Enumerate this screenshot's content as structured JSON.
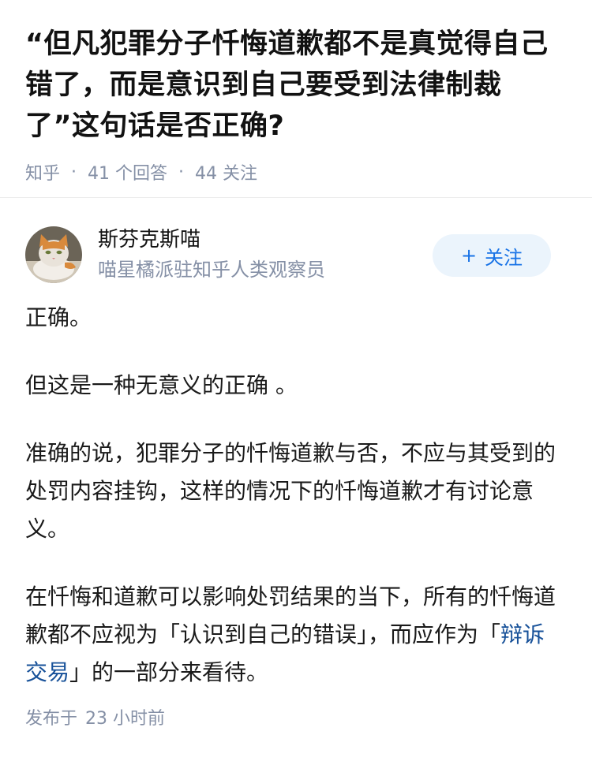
{
  "question": {
    "title": "“但凡犯罪分子忏悔道歉都不是真觉得自己错了，而是意识到自己要受到法律制裁了”这句话是否正确?",
    "site": "知乎",
    "answers": "41 个回答",
    "followers": "44 关注",
    "separator": "·"
  },
  "author": {
    "name": "斯芬克斯喵",
    "bio": "喵星橘派驻知乎人类观察员",
    "avatar_icon": "cat-avatar",
    "follow_label": "关注",
    "follow_plus": "+"
  },
  "answer": {
    "p1": "正确。",
    "p2": "但这是一种无意义的正确 。",
    "p3": "准确的说，犯罪分子的忏悔道歉与否，不应与其受到的处罚内容挂钩，这样的情况下的忏悔道歉才有讨论意义。",
    "p4_before": "在忏悔和道歉可以影响处罚结果的当下，所有的忏悔道歉都不应视为「认识到自己的错误」，而应作为「",
    "p4_link": "辩诉交易",
    "p4_after": "」的一部分来看待。"
  },
  "footer": {
    "published_label": "发布于",
    "time": "23 小时前"
  },
  "colors": {
    "meta_gray": "#8590a6",
    "follow_bg": "#ebf4fc",
    "follow_text": "#1772e6",
    "link": "#175199"
  }
}
